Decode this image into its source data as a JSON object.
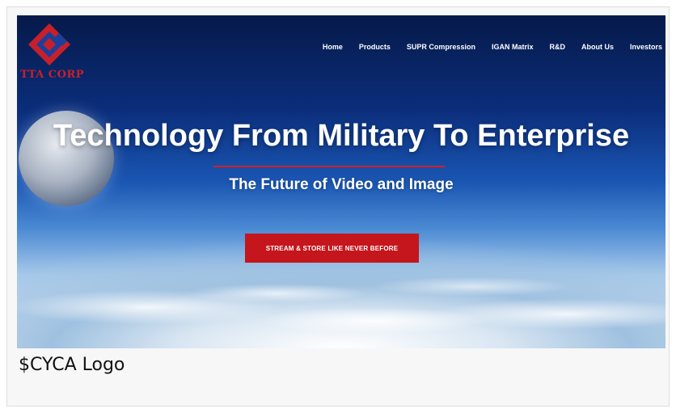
{
  "screenshot": {
    "logo": {
      "icon": "tta-diamond-logo-icon",
      "text": "TTA CORP",
      "colors": {
        "red": "#c8202a",
        "blue": "#1d3f99"
      }
    },
    "nav": {
      "items": [
        {
          "label": "Home"
        },
        {
          "label": "Products"
        },
        {
          "label": "SUPR Compression"
        },
        {
          "label": "IGAN Matrix"
        },
        {
          "label": "R&D"
        },
        {
          "label": "About Us"
        },
        {
          "label": "Investors"
        }
      ]
    },
    "hero": {
      "headline": "Technology From Military To Enterprise",
      "subheadline": "The Future of Video and Image",
      "cta_label": "STREAM & STORE LIKE NEVER BEFORE",
      "cta_color": "#c4161c"
    }
  },
  "caption": "$CYCA Logo"
}
